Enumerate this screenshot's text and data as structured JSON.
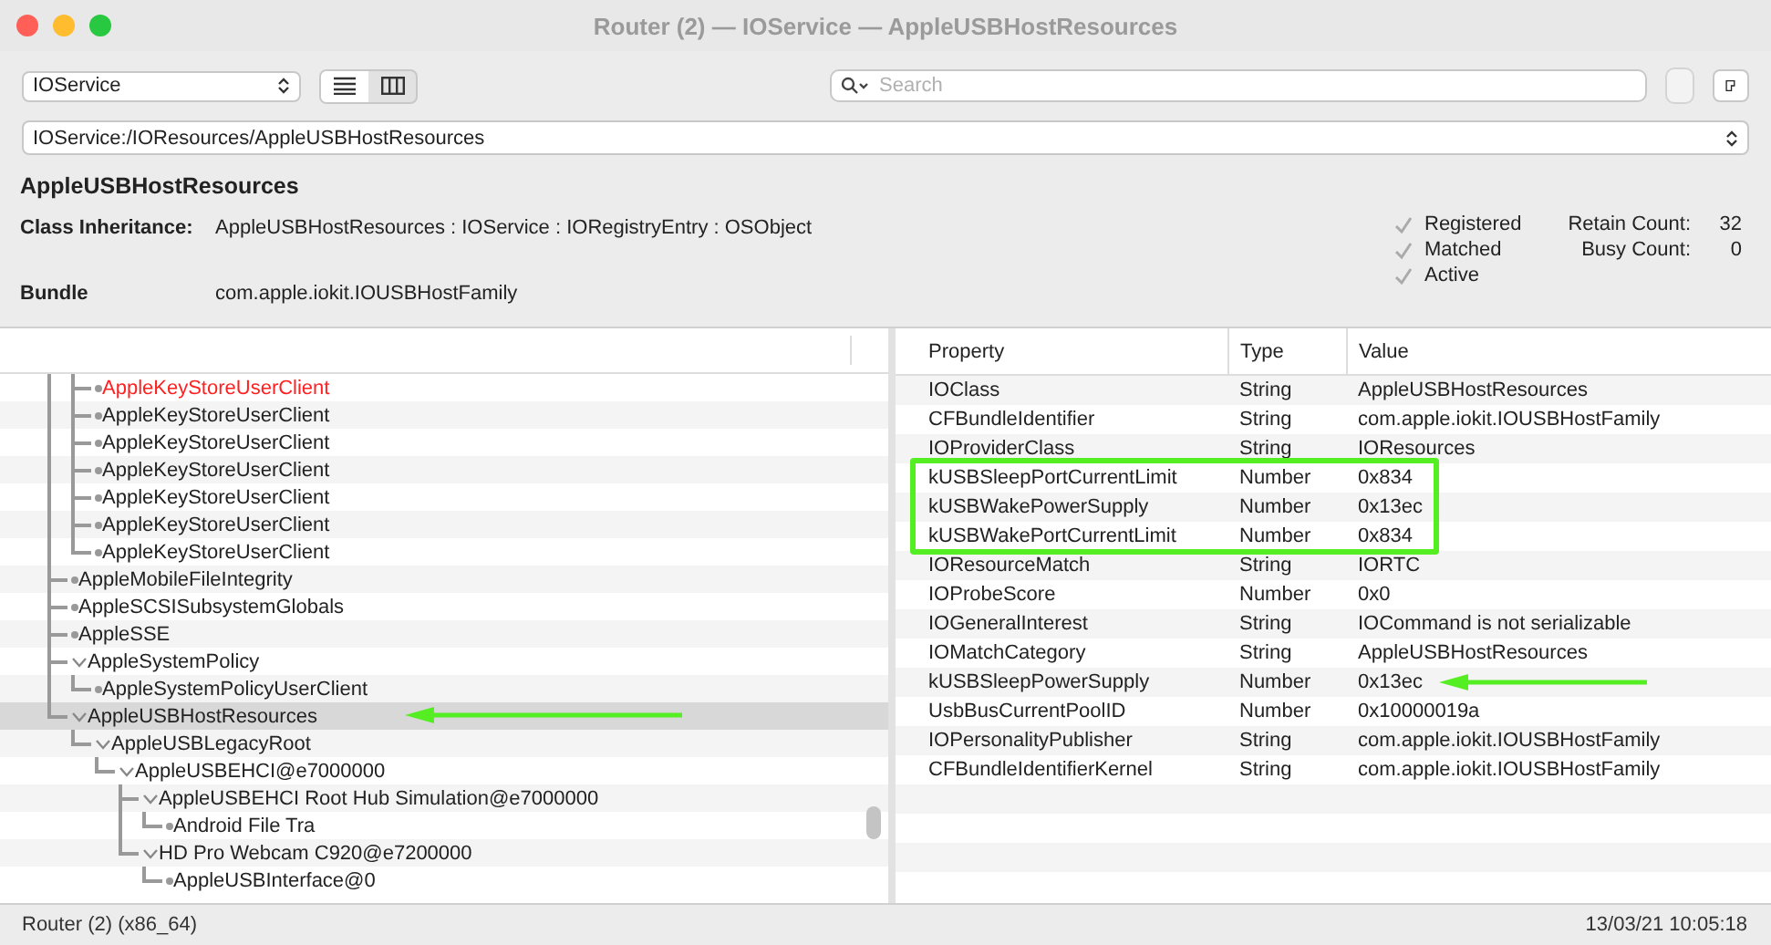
{
  "window": {
    "title": "Router (2) — IOService — AppleUSBHostResources"
  },
  "toolbar": {
    "plane": "IOService",
    "view_modes": [
      {
        "kind": "list",
        "selected": true
      },
      {
        "kind": "columns",
        "selected": false
      }
    ],
    "search": {
      "placeholder": "Search"
    }
  },
  "path": "IOService:/IOResources/AppleUSBHostResources",
  "details": {
    "name": "AppleUSBHostResources",
    "inheritance_label": "Class Inheritance:",
    "inheritance": "AppleUSBHostResources : IOService : IORegistryEntry : OSObject",
    "bundle_label": "Bundle",
    "bundle": "com.apple.iokit.IOUSBHostFamily",
    "flags": [
      {
        "label": "Registered",
        "checked": true
      },
      {
        "label": "Matched",
        "checked": true
      },
      {
        "label": "Active",
        "checked": true
      }
    ],
    "counts": [
      {
        "label": "Retain Count:",
        "value": "32"
      },
      {
        "label": "Busy Count:",
        "value": "0"
      }
    ]
  },
  "tree": [
    {
      "children": [
        {
          "label": "AppleKeyStoreUserClient",
          "color": "#ff2020"
        },
        {
          "label": "AppleKeyStoreUserClient"
        },
        {
          "label": "AppleKeyStoreUserClient"
        },
        {
          "label": "AppleKeyStoreUserClient"
        },
        {
          "label": "AppleKeyStoreUserClient"
        },
        {
          "label": "AppleKeyStoreUserClient"
        },
        {
          "label": "AppleKeyStoreUserClient"
        }
      ]
    },
    {
      "label": "AppleMobileFileIntegrity"
    },
    {
      "label": "AppleSCSISubsystemGlobals"
    },
    {
      "label": "AppleSSE"
    },
    {
      "label": "AppleSystemPolicy",
      "expanded": true,
      "children": [
        {
          "label": "AppleSystemPolicyUserClient"
        }
      ]
    },
    {
      "label": "AppleUSBHostResources",
      "expanded": true,
      "selected": true,
      "arrow": true,
      "children": [
        {
          "label": "AppleUSBLegacyRoot",
          "expanded": true,
          "children": [
            {
              "label": "AppleUSBEHCI@e7000000",
              "expanded": true,
              "children": [
                {
                  "label": "AppleUSBEHCI Root Hub Simulation@e7000000",
                  "expanded": true,
                  "children": [
                    {
                      "label": "Android File Tra"
                    }
                  ]
                },
                {
                  "label": "HD Pro Webcam C920@e7200000",
                  "expanded": true,
                  "children": [
                    {
                      "label": "AppleUSBInterface@0"
                    }
                  ]
                }
              ]
            }
          ]
        }
      ]
    }
  ],
  "properties": {
    "columns": [
      "Property",
      "Type",
      "Value"
    ],
    "rows": [
      {
        "property": "IOClass",
        "type": "String",
        "value": "AppleUSBHostResources"
      },
      {
        "property": "CFBundleIdentifier",
        "type": "String",
        "value": "com.apple.iokit.IOUSBHostFamily"
      },
      {
        "property": "IOProviderClass",
        "type": "String",
        "value": "IOResources"
      },
      {
        "property": "kUSBSleepPortCurrentLimit",
        "type": "Number",
        "value": "0x834",
        "highlighted": true
      },
      {
        "property": "kUSBWakePowerSupply",
        "type": "Number",
        "value": "0x13ec",
        "highlighted": true
      },
      {
        "property": "kUSBWakePortCurrentLimit",
        "type": "Number",
        "value": "0x834",
        "highlighted": true
      },
      {
        "property": "IOResourceMatch",
        "type": "String",
        "value": "IORTC"
      },
      {
        "property": "IOProbeScore",
        "type": "Number",
        "value": "0x0"
      },
      {
        "property": "IOGeneralInterest",
        "type": "String",
        "value": "IOCommand is not serializable"
      },
      {
        "property": "IOMatchCategory",
        "type": "String",
        "value": "AppleUSBHostResources"
      },
      {
        "property": "kUSBSleepPowerSupply",
        "type": "Number",
        "value": "0x13ec",
        "arrow": true
      },
      {
        "property": "UsbBusCurrentPoolID",
        "type": "Number",
        "value": "0x10000019a"
      },
      {
        "property": "IOPersonalityPublisher",
        "type": "String",
        "value": "com.apple.iokit.IOUSBHostFamily"
      },
      {
        "property": "CFBundleIdentifierKernel",
        "type": "String",
        "value": "com.apple.iokit.IOUSBHostFamily"
      }
    ]
  },
  "status_bar": {
    "left": "Router (2) (x86_64)",
    "right": "13/03/21 10:05:18"
  }
}
